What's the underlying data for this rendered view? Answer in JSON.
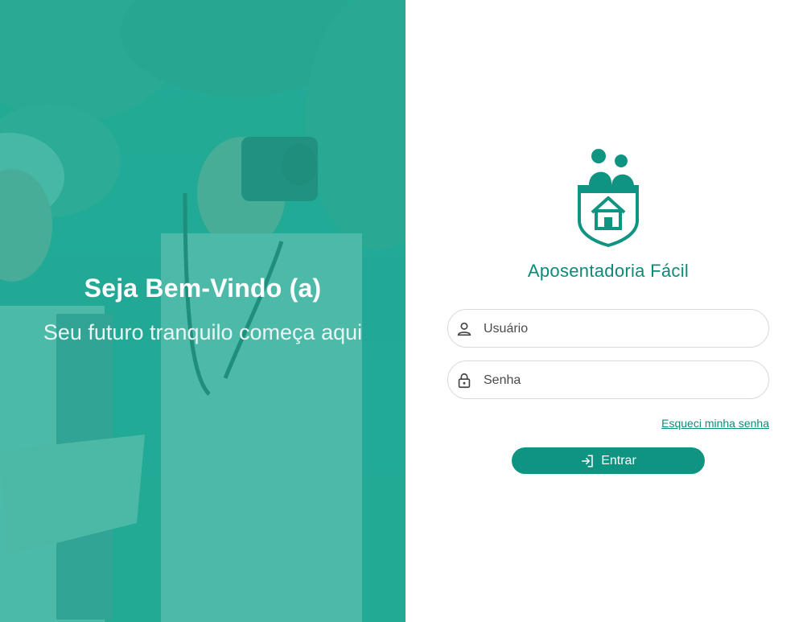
{
  "hero": {
    "title": "Seja Bem-Vindo (a)",
    "subtitle": "Seu futuro tranquilo começa aqui",
    "overlay_color": "#20aa96"
  },
  "brand": {
    "name": "Aposentadoria Fácil",
    "logo_icon": "shield-house-couple-icon",
    "color": "#0c8a77"
  },
  "form": {
    "username": {
      "placeholder": "Usuário",
      "value": "",
      "icon": "user-icon"
    },
    "password": {
      "placeholder": "Senha",
      "value": "",
      "icon": "lock-icon"
    },
    "forgot_label": "Esqueci minha senha",
    "submit": {
      "label": "Entrar",
      "icon": "login-icon",
      "color": "#0f9482"
    }
  }
}
